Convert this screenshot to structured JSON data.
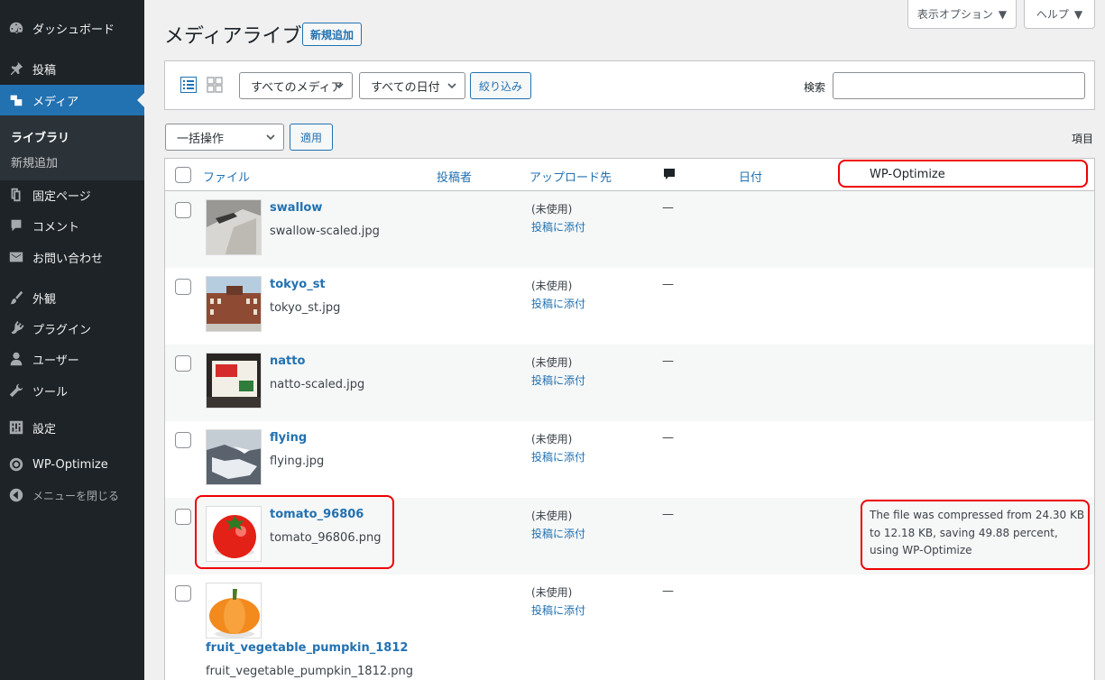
{
  "sidebar": {
    "items": [
      {
        "label": "ダッシュボード",
        "icon": "dashboard-icon"
      },
      {
        "label": "投稿",
        "icon": "pin-icon"
      },
      {
        "label": "メディア",
        "icon": "media-icon"
      },
      {
        "label": "固定ページ",
        "icon": "page-icon"
      },
      {
        "label": "コメント",
        "icon": "comment-icon"
      },
      {
        "label": "お問い合わせ",
        "icon": "mail-icon"
      },
      {
        "label": "外観",
        "icon": "brush-icon"
      },
      {
        "label": "プラグイン",
        "icon": "plugin-icon"
      },
      {
        "label": "ユーザー",
        "icon": "user-icon"
      },
      {
        "label": "ツール",
        "icon": "wrench-icon"
      },
      {
        "label": "設定",
        "icon": "settings-icon"
      },
      {
        "label": "WP-Optimize",
        "icon": "wp-optimize-icon"
      },
      {
        "label": "メニューを閉じる",
        "icon": "collapse-icon"
      }
    ],
    "submenu": [
      "ライブラリ",
      "新規追加"
    ]
  },
  "top": {
    "screen_options": "表示オプション",
    "help": "ヘルプ"
  },
  "page": {
    "title": "メディアライブラリ",
    "add_new": "新規追加"
  },
  "filters": {
    "media_type": "すべてのメディア",
    "date": "すべての日付",
    "filter_button": "絞り込み",
    "search_label": "検索",
    "search_value": ""
  },
  "bulk": {
    "action": "一括操作",
    "apply": "適用",
    "items_label": "項目"
  },
  "columns": {
    "file": "ファイル",
    "author": "投稿者",
    "uploaded_to": "アップロード先",
    "date": "日付",
    "wpo": "WP-Optimize"
  },
  "rows": [
    {
      "title": "swallow",
      "file": "swallow-scaled.jpg",
      "uploaded": "(未使用)",
      "attach": "投稿に添付",
      "comments": "—",
      "wpo": ""
    },
    {
      "title": "tokyo_st",
      "file": "tokyo_st.jpg",
      "uploaded": "(未使用)",
      "attach": "投稿に添付",
      "comments": "—",
      "wpo": ""
    },
    {
      "title": "natto",
      "file": "natto-scaled.jpg",
      "uploaded": "(未使用)",
      "attach": "投稿に添付",
      "comments": "—",
      "wpo": ""
    },
    {
      "title": "flying",
      "file": "flying.jpg",
      "uploaded": "(未使用)",
      "attach": "投稿に添付",
      "comments": "—",
      "wpo": ""
    },
    {
      "title": "tomato_96806",
      "file": "tomato_96806.png",
      "uploaded": "(未使用)",
      "attach": "投稿に添付",
      "comments": "—",
      "wpo": "The file was compressed from 24.30 KB to 12.18 KB, saving 49.88 percent, using WP-Optimize"
    },
    {
      "title": "fruit_vegetable_pumpkin_1812",
      "file": "fruit_vegetable_pumpkin_1812.png",
      "uploaded": "(未使用)",
      "attach": "投稿に添付",
      "comments": "—",
      "wpo": ""
    }
  ],
  "colors": {
    "sidebar": "#1d2327",
    "accent": "#2271b1",
    "highlight": "#e00000"
  }
}
